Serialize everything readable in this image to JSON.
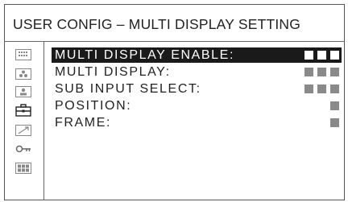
{
  "title": "USER CONFIG – MULTI DISPLAY SETTING",
  "sidebar": {
    "icons": [
      "status-icon",
      "color-adjust-icon",
      "input-icon",
      "toolbox-icon",
      "chart-icon",
      "key-icon",
      "multi-display-icon"
    ]
  },
  "menu": {
    "items": [
      {
        "label": "MULTI DISPLAY ENABLE:",
        "value_blocks": 3,
        "selected": true
      },
      {
        "label": "MULTI DISPLAY:",
        "value_blocks": 3,
        "selected": false
      },
      {
        "label": "SUB INPUT SELECT:",
        "value_blocks": 3,
        "selected": false
      },
      {
        "label": "POSITION:",
        "value_blocks": 1,
        "selected": false
      },
      {
        "label": "FRAME:",
        "value_blocks": 1,
        "selected": false
      }
    ]
  },
  "colors": {
    "highlight_bg": "#1a1a1a",
    "highlight_text": "#ffffff",
    "value_block": "#8a8a8a"
  }
}
